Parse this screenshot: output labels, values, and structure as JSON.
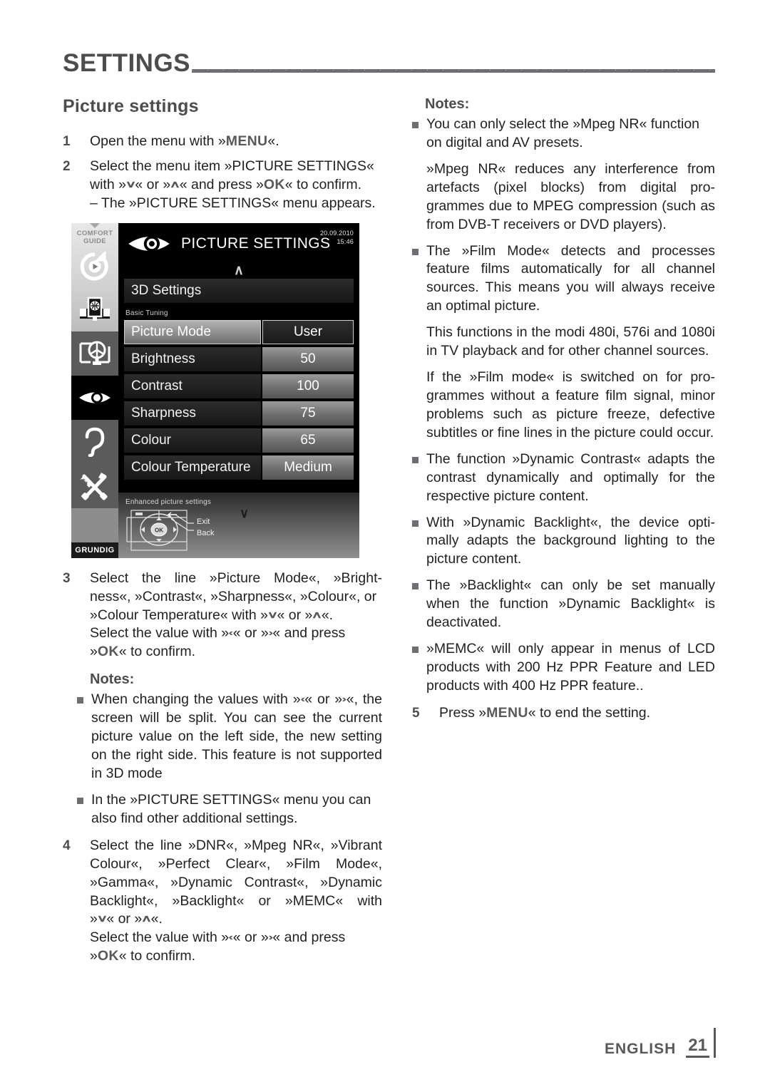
{
  "header": {
    "title": "SETTINGS"
  },
  "left": {
    "section_title": "Picture settings",
    "steps": [
      {
        "num": "1",
        "parts": [
          {
            "t": "text",
            "v": "Open the menu with »"
          },
          {
            "t": "kbd",
            "v": "MENU"
          },
          {
            "t": "text",
            "v": "«."
          }
        ]
      }
    ],
    "step2_num": "2",
    "step2_line1": "Select the menu item »PICTURE SETTINGS«",
    "step2_line2_a": "with »",
    "step2_line2_down": "∨",
    "step2_line2_b": "« or »",
    "step2_line2_up": "∧",
    "step2_line2_c": "« and press »",
    "step2_line2_ok": "OK",
    "step2_line2_d": "« to confirm.",
    "step2_line3": "– The »PICTURE SETTINGS« menu appears.",
    "step3_num": "3",
    "step3_line1": "Select the line »Picture Mode«, »Bright-",
    "step3_line2": "ness«, »Contrast«, »Sharpness«, »Colour«, or",
    "step3_line3_a": "»Colour Temperature« with »",
    "step3_line3_down": "∨",
    "step3_line3_b": "« or »",
    "step3_line3_up": "∧",
    "step3_line3_c": "«.",
    "step3_line4_a": "Select the value with »",
    "step3_line4_left": "‹",
    "step3_line4_b": "« or »",
    "step3_line4_right": "›",
    "step3_line4_c": "« and press",
    "step3_line5_a": "»",
    "step3_line5_ok": "OK",
    "step3_line5_b": "« to confirm.",
    "notes_head": "Notes:",
    "note1_a": "When changing the values with »",
    "note1_left": "‹",
    "note1_b": "« or »",
    "note1_right": "›",
    "note1_c": "«, the screen will be split. You can see the current picture value on the left side, the new setting on the right side. This feature is not supported in 3D mode",
    "note2": "In the »PICTURE SETTINGS« menu you can also find other additional settings.",
    "step4_num": "4",
    "step4_line1": "Select the line »DNR«, »Mpeg NR«, »Vibrant Colour«, »Perfect Clear«, »Film Mode«, »Gamma«, »Dynamic Contrast«, »Dynamic Backlight«, »Backlight« or »MEMC« with",
    "step4_line2_a": "»",
    "step4_line2_down": "∨",
    "step4_line2_b": "« or »",
    "step4_line2_up": "∧",
    "step4_line2_c": "«.",
    "step4_line3_a": "Select the value with »",
    "step4_line3_left": "‹",
    "step4_line3_b": "« or »",
    "step4_line3_right": "›",
    "step4_line3_c": "« and press",
    "step4_line4_a": "»",
    "step4_line4_ok": "OK",
    "step4_line4_b": "« to confirm."
  },
  "tv_menu": {
    "sidebar": {
      "top_label_line1": "COMFORT",
      "top_label_line2": "GUIDE",
      "icons": [
        "media-playback-icon",
        "source-select-icon",
        "channel-settings-icon",
        "picture-settings-icon",
        "sound-settings-icon",
        "tools-settings-icon"
      ],
      "brand": "GRUNDIG"
    },
    "title": "PICTURE SETTINGS",
    "date": "20.09.2010",
    "time": "15:46",
    "top_item": "3D Settings",
    "group_caption": "Basic Tuning",
    "rows": [
      {
        "label": "Picture Mode",
        "value": "User",
        "selected": true
      },
      {
        "label": "Brightness",
        "value": "50",
        "selected": false
      },
      {
        "label": "Contrast",
        "value": "100",
        "selected": false
      },
      {
        "label": "Sharpness",
        "value": "75",
        "selected": false
      },
      {
        "label": "Colour",
        "value": "65",
        "selected": false
      },
      {
        "label": "Colour Temperature",
        "value": "Medium",
        "selected": false
      }
    ],
    "hint": "Enhanced picture settings",
    "remote_ok": "OK",
    "remote_exit": "Exit",
    "remote_back": "Back",
    "chevron_up": "∧",
    "chevron_down": "∨"
  },
  "right": {
    "notes_head": "Notes:",
    "note1": "You can only select the »Mpeg NR« function on digital and AV presets.",
    "note1_sub": "»Mpeg NR«  reduces any interference from artefacts (pixel blocks) from digital pro-grammes due to MPEG compression (such as from DVB-T receivers or DVD players).",
    "note2": "The »Film Mode« detects and processes feature films automatically for all channel sources. This means you will always receive an optimal picture.",
    "note2_sub1": "This functions in the modi 480i, 576i and 1080i in TV playback and for other channel sources.",
    "note2_sub2": "If the »Film mode« is switched on for pro-grammes without a feature film signal, minor problems such as picture freeze, defective subtitles or fine lines in the picture could occur.",
    "note3": "The function »Dynamic Contrast« adapts the contrast dynamically and optimally for the respective picture content.",
    "note4": "With »Dynamic Backlight«, the device opti-mally adapts the background lighting to the picture content.",
    "note5": "The »Backlight« can only be set manually when the function »Dynamic Backlight« is deactivated.",
    "note6": "»MEMC« will only appear in menus of LCD products with 200 Hz PPR Feature and LED products with 400 Hz PPR feature..",
    "step5_num": "5",
    "step5_a": "Press »",
    "step5_kbd": "MENU",
    "step5_b": "« to end the setting."
  },
  "footer": {
    "language": "ENGLISH",
    "page": "21"
  }
}
